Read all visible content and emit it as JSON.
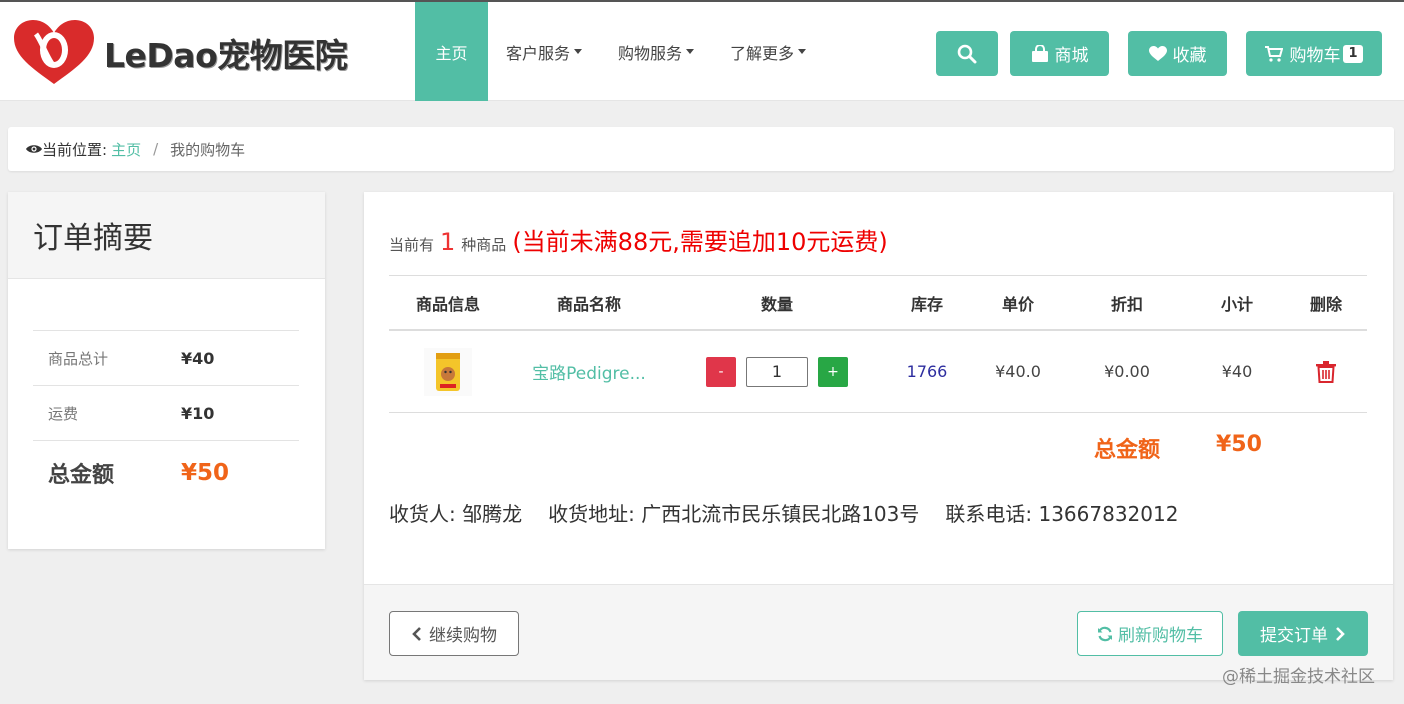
{
  "colors": {
    "accent": "#52bea5",
    "danger": "#e0364a",
    "success": "#28a745",
    "price_orange": "#f06419",
    "warning_red": "#e00000"
  },
  "header": {
    "logo_text": "LeDao宠物医院",
    "nav": [
      {
        "label": "主页",
        "active": true
      },
      {
        "label": "客户服务"
      },
      {
        "label": "购物服务"
      },
      {
        "label": "了解更多"
      }
    ],
    "search_icon": "search-icon",
    "mall_label": "商城",
    "favorites_label": "收藏",
    "cart_label": "购物车",
    "cart_count": "1"
  },
  "breadcrumb": {
    "prefix": "当前位置:",
    "home": "主页",
    "separator": "/",
    "current": "我的购物车"
  },
  "summary": {
    "title": "订单摘要",
    "rows": [
      {
        "label": "商品总计",
        "value": "¥40"
      },
      {
        "label": "运费",
        "value": "¥10"
      }
    ],
    "total_label": "总金额",
    "total_value": "¥50"
  },
  "cart": {
    "info_prefix": "当前有",
    "item_count": "1",
    "info_suffix": "种商品",
    "shipping_warning": "(当前未满88元,需要追加10元运费)",
    "columns": [
      "商品信息",
      "商品名称",
      "数量",
      "库存",
      "单价",
      "折扣",
      "小计",
      "删除"
    ],
    "items": [
      {
        "name": "宝路Pedigre...",
        "minus": "-",
        "quantity": "1",
        "plus": "+",
        "stock": "1766",
        "unit_price": "¥40.0",
        "discount": "¥0.00",
        "subtotal": "¥40"
      }
    ],
    "grand_total_label": "总金额",
    "grand_total_value": "¥50",
    "receiver": "收货人: 邹腾龙",
    "address": "收货地址: 广西北流市民乐镇民北路103号",
    "phone": "联系电话: 13667832012",
    "continue_label": "继续购物",
    "refresh_label": "刷新购物车",
    "submit_label": "提交订单"
  },
  "watermark": "@稀土掘金技术社区"
}
